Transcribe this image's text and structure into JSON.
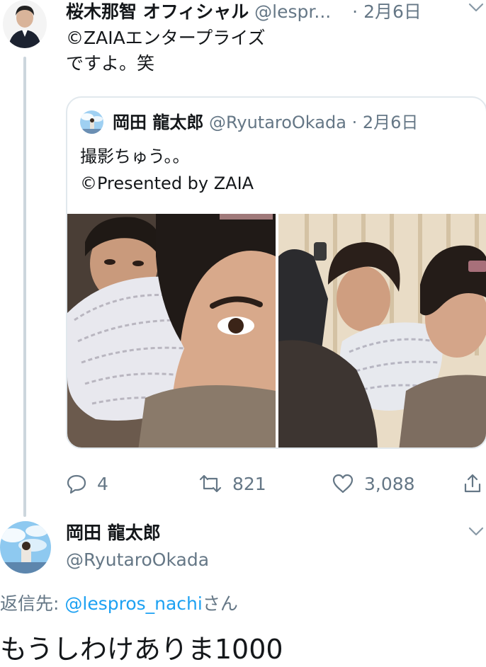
{
  "tweet": {
    "author_name": "桜木那智 オフィシャル",
    "author_handle": "@lespr...",
    "separator": "·",
    "date": "2月6日",
    "text_line1": "©ZAIAエンタープライズ",
    "text_line2": "ですよ。笑"
  },
  "quoted": {
    "author_name": "岡田 龍太郎",
    "author_handle": "@RyutaroOkada",
    "separator": "·",
    "date": "2月6日",
    "text_line1": "撮影ちゅう。。",
    "text_line2": "©Presented by ZAIA"
  },
  "actions": {
    "replies": "4",
    "retweets": "821",
    "likes": "3,088"
  },
  "reply": {
    "author_name": "岡田 龍太郎",
    "author_handle": "@RyutaroOkada",
    "reply_prefix": "返信先: ",
    "reply_mention": "@lespros_nachi",
    "reply_suffix": "さん",
    "text": "もうしわけありま1000"
  },
  "colors": {
    "link": "#1da1f2",
    "muted": "#657786",
    "thread_line": "#ccd6dd",
    "border": "#e1e8ed"
  },
  "icons": [
    "chevron-down-icon",
    "reply-icon",
    "retweet-icon",
    "like-icon",
    "share-icon"
  ]
}
